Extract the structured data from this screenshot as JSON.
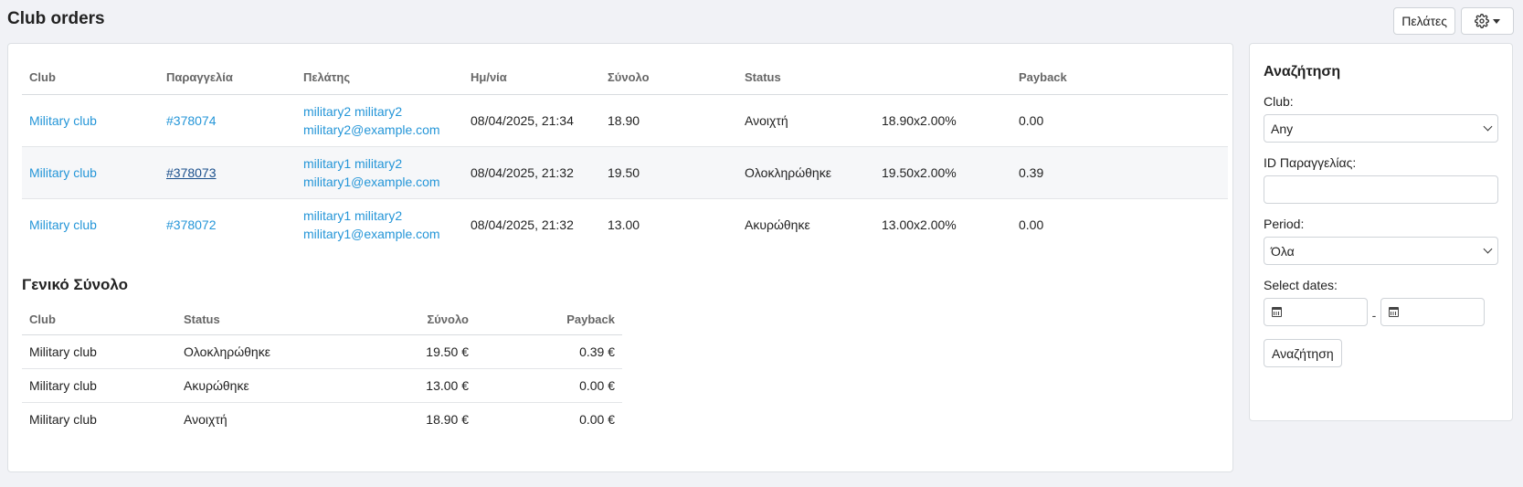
{
  "page": {
    "title": "Club orders"
  },
  "toolbar": {
    "customers_label": "Πελάτες"
  },
  "orders": {
    "headers": [
      "Club",
      "Παραγγελία",
      "Πελάτης",
      "Ημ/νία",
      "Σύνολο",
      "Status",
      "",
      "Payback"
    ],
    "rows": [
      {
        "club": "Military club",
        "order": "#378074",
        "customer_name": "military2 military2",
        "customer_email": "military2@example.com",
        "date": "08/04/2025, 21:34",
        "total": "18.90",
        "status": "Ανοιχτή",
        "calc": "18.90x2.00%",
        "payback": "0.00"
      },
      {
        "club": "Military club",
        "order": "#378073",
        "customer_name": "military1 military2",
        "customer_email": "military1@example.com",
        "date": "08/04/2025, 21:32",
        "total": "19.50",
        "status": "Ολοκληρώθηκε",
        "calc": "19.50x2.00%",
        "payback": "0.39"
      },
      {
        "club": "Military club",
        "order": "#378072",
        "customer_name": "military1 military2",
        "customer_email": "military1@example.com",
        "date": "08/04/2025, 21:32",
        "total": "13.00",
        "status": "Ακυρώθηκε",
        "calc": "13.00x2.00%",
        "payback": "0.00"
      }
    ]
  },
  "summary": {
    "title": "Γενικό Σύνολο",
    "headers": [
      "Club",
      "Status",
      "Σύνολο",
      "Payback"
    ],
    "rows": [
      {
        "club": "Military club",
        "status": "Ολοκληρώθηκε",
        "total": "19.50 €",
        "payback": "0.39 €"
      },
      {
        "club": "Military club",
        "status": "Ακυρώθηκε",
        "total": "13.00 €",
        "payback": "0.00 €"
      },
      {
        "club": "Military club",
        "status": "Ανοιχτή",
        "total": "18.90 €",
        "payback": "0.00 €"
      }
    ]
  },
  "search": {
    "title": "Αναζήτηση",
    "club_label": "Club:",
    "club_value": "Any",
    "order_id_label": "ID Παραγγελίας:",
    "order_id_value": "",
    "period_label": "Period:",
    "period_value": "Όλα",
    "dates_label": "Select dates:",
    "date_separator": "-",
    "button_label": "Αναζήτηση"
  },
  "icons": {
    "settings": "gear-icon",
    "calendar": "calendar-icon",
    "dropdown": "chevron-down-icon"
  },
  "colors": {
    "link": "#2596d8",
    "visited_link": "#1a4f8c",
    "background": "#f1f2f6"
  }
}
